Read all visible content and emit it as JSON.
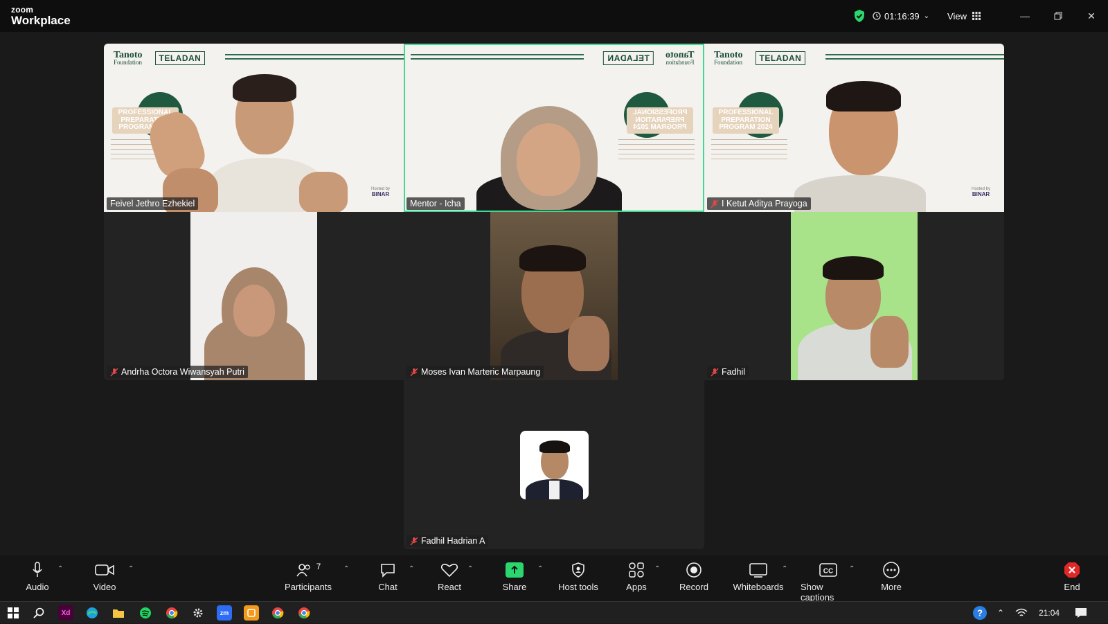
{
  "app": {
    "brand_small": "zoom",
    "brand_name": "Workplace"
  },
  "titlebar": {
    "timer": "01:16:39",
    "view_label": "View"
  },
  "participants": [
    {
      "name": "Feivel Jethro Ezhekiel",
      "muted": false
    },
    {
      "name": "Mentor - Icha",
      "muted": false,
      "active_speaker": true
    },
    {
      "name": "I Ketut Aditya Prayoga",
      "muted": true
    },
    {
      "name": "Andrha Octora Wiwansyah Putri",
      "muted": true
    },
    {
      "name": "Moses Ivan Marteric Marpaung",
      "muted": true
    },
    {
      "name": "Fadhil",
      "muted": true
    },
    {
      "name": "Fadhil Hadrian A",
      "muted": true
    }
  ],
  "background": {
    "brand_title": "Tanoto",
    "brand_sub": "Foundation",
    "brand_tag": "TELADAN",
    "program_line1": "PROFESSIONAL",
    "program_line2": "PREPARATION",
    "program_line3": "PROGRAM 2024",
    "hosted_by": "Hosted by",
    "host": "BINAR"
  },
  "toolbar": {
    "audio": "Audio",
    "video": "Video",
    "participants": "Participants",
    "participants_count": "7",
    "chat": "Chat",
    "react": "React",
    "share": "Share",
    "host_tools": "Host tools",
    "apps": "Apps",
    "record": "Record",
    "whiteboards": "Whiteboards",
    "captions": "Show captions",
    "more": "More",
    "end": "End"
  },
  "taskbar": {
    "time": "21:04",
    "xd_label": "Xd",
    "zoom_label": "zm"
  },
  "colors": {
    "active_border": "#3fd98f",
    "brand_green": "#1f5a40",
    "share_green": "#2bd66f",
    "end_red": "#e02828"
  }
}
